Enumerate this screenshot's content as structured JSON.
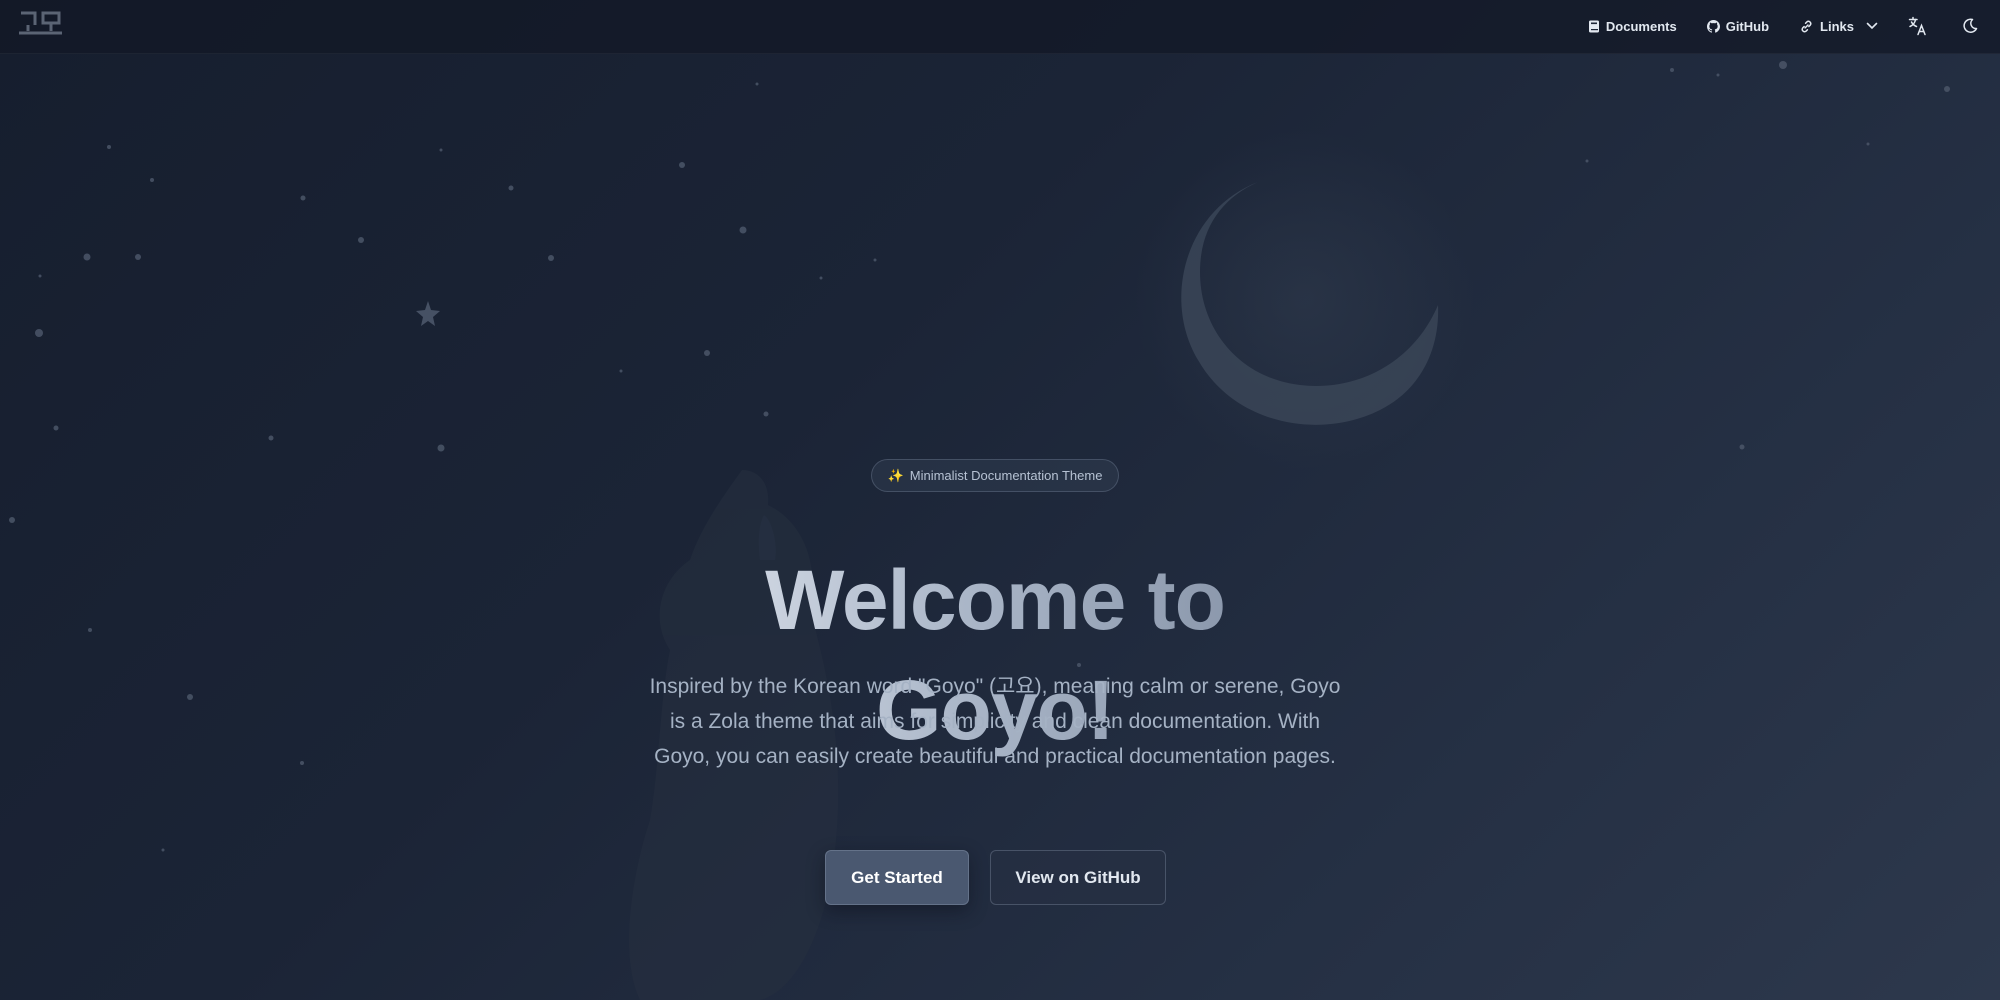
{
  "navbar": {
    "logo_icon": "goyo-logo-icon",
    "items": [
      {
        "label": "Documents",
        "icon": "book-icon"
      },
      {
        "label": "GitHub",
        "icon": "github-icon"
      },
      {
        "label": "Links",
        "icon": "link-icon",
        "dropdown_icon": "chevron-down-icon"
      }
    ],
    "language_icon": "translate-icon",
    "theme_icon": "moon-icon"
  },
  "hero": {
    "badge": {
      "emoji": "✨",
      "label": "Minimalist Documentation Theme"
    },
    "title": "Welcome to Goyo!",
    "description": "Inspired by the Korean word \"Goyo\" (고요), meaning calm or serene, Goyo is a Zola theme that aims for simplicity and clean documentation. With Goyo, you can easily create beautiful and practical documentation pages.",
    "primary_button": "Get Started",
    "secondary_button": "View on GitHub"
  },
  "colors": {
    "background_start": "#161e2e",
    "background_end": "#2d384c",
    "primary_button": "#4a5870",
    "text_muted": "#a5b2c4"
  }
}
